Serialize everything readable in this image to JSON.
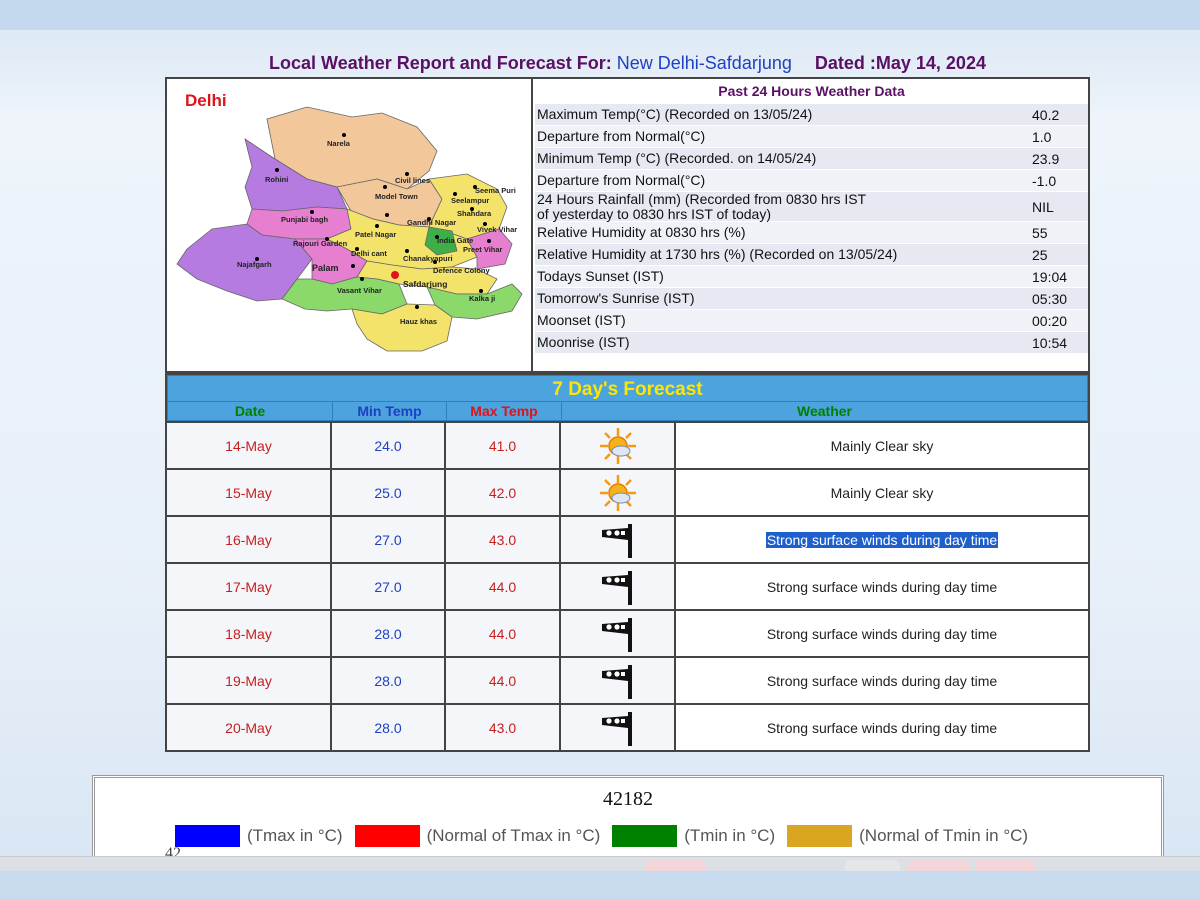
{
  "header": {
    "prefix": "Local Weather Report and Forecast For:",
    "station": "New Delhi-Safdarjung",
    "dated": "Dated :May 14, 2024"
  },
  "map": {
    "title": "Delhi",
    "districts": {
      "narela": "Narela",
      "rohini": "Rohini",
      "civil_lines": "Civil lines",
      "model_town": "Model Town",
      "seema_puri": "Seema Puri",
      "seelampur": "Seelampur",
      "shahdara": "Shahdara",
      "punjabi_bagh": "Punjabi bagh",
      "karol_bagh": "Karol Bagh",
      "gandhi_nagar": "Gandhi Nagar",
      "vivek_vihar": "Vivek Vihar",
      "patel_nagar": "Patel Nagar",
      "rajouri_garden": "Rajouri Garden",
      "india_gate": "India Gate",
      "preet_vihar": "Preet Vihar",
      "najafgarh": "Najafgarh",
      "delhi_cant": "Delhi cant",
      "chanakyapuri": "Chanakyapuri",
      "palam": "Palam",
      "defence_colony": "Defence Colony",
      "vasant_vihar": "Vasant Vihar",
      "safdarjung": "Safdarjung",
      "kalkaji": "Kalka ji",
      "hauz_khas": "Hauz khas"
    }
  },
  "past24": {
    "title": "Past 24 Hours Weather Data",
    "rows": [
      {
        "label": "Maximum Temp(°C) (Recorded on 13/05/24)",
        "value": "40.2"
      },
      {
        "label": "Departure from Normal(°C)",
        "value": "1.0"
      },
      {
        "label": "Minimum Temp (°C) (Recorded. on 14/05/24)",
        "value": "23.9"
      },
      {
        "label": "Departure from Normal(°C)",
        "value": "-1.0"
      },
      {
        "label": "24 Hours Rainfall (mm) (Recorded from 0830 hrs IST\nof yesterday to 0830 hrs IST of today)",
        "value": "NIL"
      },
      {
        "label": "Relative Humidity at 0830 hrs (%)",
        "value": "55"
      },
      {
        "label": "Relative Humidity at 1730 hrs (%) (Recorded on 13/05/24)",
        "value": "25"
      },
      {
        "label": "Todays Sunset (IST)",
        "value": "19:04"
      },
      {
        "label": "Tomorrow's Sunrise (IST)",
        "value": "05:30"
      },
      {
        "label": "Moonset (IST)",
        "value": "00:20"
      },
      {
        "label": "Moonrise (IST)",
        "value": "10:54"
      }
    ]
  },
  "forecast": {
    "title": "7 Day's Forecast",
    "columns": {
      "date": "Date",
      "min": "Min Temp",
      "max": "Max Temp",
      "weather": "Weather"
    },
    "rows": [
      {
        "date": "14-May",
        "min": "24.0",
        "max": "41.0",
        "icon": "sun-cloud-icon",
        "desc": "Mainly Clear sky",
        "selected": false
      },
      {
        "date": "15-May",
        "min": "25.0",
        "max": "42.0",
        "icon": "sun-cloud-icon",
        "desc": "Mainly Clear sky",
        "selected": false
      },
      {
        "date": "16-May",
        "min": "27.0",
        "max": "43.0",
        "icon": "strong-wind-icon",
        "desc": "Strong surface winds during day time",
        "selected": true
      },
      {
        "date": "17-May",
        "min": "27.0",
        "max": "44.0",
        "icon": "strong-wind-icon",
        "desc": "Strong surface winds during day time",
        "selected": false
      },
      {
        "date": "18-May",
        "min": "28.0",
        "max": "44.0",
        "icon": "strong-wind-icon",
        "desc": "Strong surface winds during day time",
        "selected": false
      },
      {
        "date": "19-May",
        "min": "28.0",
        "max": "44.0",
        "icon": "strong-wind-icon",
        "desc": "Strong surface winds during day time",
        "selected": false
      },
      {
        "date": "20-May",
        "min": "28.0",
        "max": "43.0",
        "icon": "strong-wind-icon",
        "desc": "Strong surface winds during day time",
        "selected": false
      }
    ]
  },
  "chart": {
    "station_id": "42182",
    "cut_label": "42",
    "legend": [
      {
        "label": "(Tmax in °C)",
        "color": "#0000ff"
      },
      {
        "label": "(Normal of Tmax in °C)",
        "color": "#ff0000"
      },
      {
        "label": "(Tmin in °C)",
        "color": "#008000"
      },
      {
        "label": "(Normal of Tmin in °C)",
        "color": "#daa520"
      }
    ]
  },
  "colors": {
    "heading": "#5a1065",
    "station": "#1f3fc4",
    "forecast_bar": "#4ca3dd",
    "forecast_title": "#ffe600",
    "date_col": "#008000",
    "min_col": "#1f3fc4",
    "max_col": "#e0121a",
    "weather_col": "#008000",
    "selection": "#1e5fcc"
  }
}
